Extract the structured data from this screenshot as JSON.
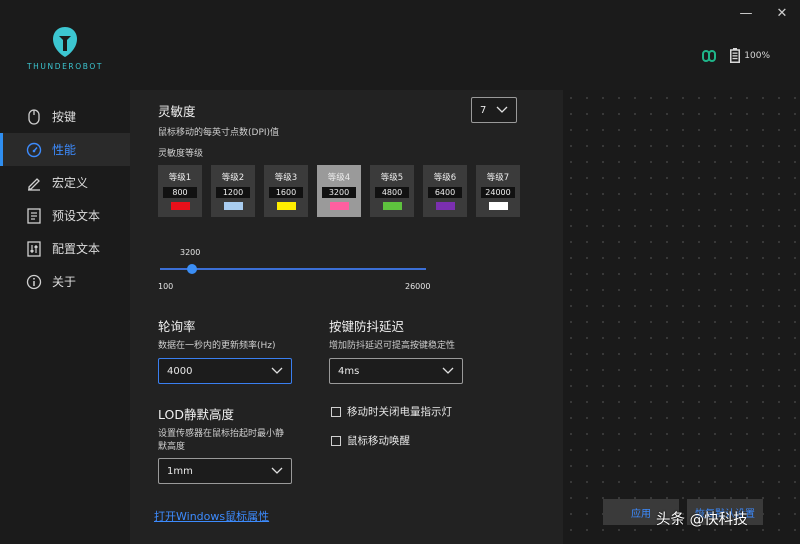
{
  "window": {
    "minimize": "—",
    "close": "✕"
  },
  "brand": {
    "name": "THUNDEROBOT",
    "color": "#3cc6d1"
  },
  "status": {
    "battery": "100%",
    "link_icon": "link-icon",
    "accent": "#1fb589"
  },
  "sidebar": {
    "items": [
      {
        "label": "按键",
        "icon": "mouse-icon"
      },
      {
        "label": "性能",
        "icon": "gauge-icon",
        "active": true
      },
      {
        "label": "宏定义",
        "icon": "pencil-icon"
      },
      {
        "label": "预设文本",
        "icon": "document-icon"
      },
      {
        "label": "配置文本",
        "icon": "sliders-icon"
      },
      {
        "label": "关于",
        "icon": "info-icon"
      }
    ]
  },
  "sensitivity": {
    "title": "灵敏度",
    "level_count": "7",
    "dpi_desc": "鼠标移动的每英寸点数(DPI)值",
    "levels_label": "灵敏度等级",
    "levels": [
      {
        "name": "等级1",
        "dpi": "800",
        "color": "#e8101a"
      },
      {
        "name": "等级2",
        "dpi": "1200",
        "color": "#a9cdf0"
      },
      {
        "name": "等级3",
        "dpi": "1600",
        "color": "#ffee00"
      },
      {
        "name": "等级4",
        "dpi": "3200",
        "color": "#ff5fa0",
        "selected": true
      },
      {
        "name": "等级5",
        "dpi": "4800",
        "color": "#5ec23e"
      },
      {
        "name": "等级6",
        "dpi": "6400",
        "color": "#7b2fb0"
      },
      {
        "name": "等级7",
        "dpi": "24000",
        "color": "#ffffff"
      }
    ],
    "slider": {
      "value": "3200",
      "min": "100",
      "max": "26000",
      "fraction": 0.1197
    }
  },
  "polling": {
    "title": "轮询率",
    "desc": "数据在一秒内的更新频率(Hz)",
    "value": "4000"
  },
  "debounce": {
    "title": "按键防抖延迟",
    "desc": "增加防抖延迟可提高按键稳定性",
    "value": "4ms"
  },
  "lod": {
    "title": "LOD静默高度",
    "desc_line1": "设置传感器在鼠标抬起时最小静",
    "desc_line2": "默高度",
    "value": "1mm"
  },
  "options": {
    "disable_indicator": "移动时关闭电量指示灯",
    "wake_on_move": "鼠标移动唤醒"
  },
  "link": "打开Windows鼠标属性",
  "buttons": {
    "apply": "应用",
    "reset": "恢复默认设置"
  },
  "watermark": "头条 @快科技"
}
